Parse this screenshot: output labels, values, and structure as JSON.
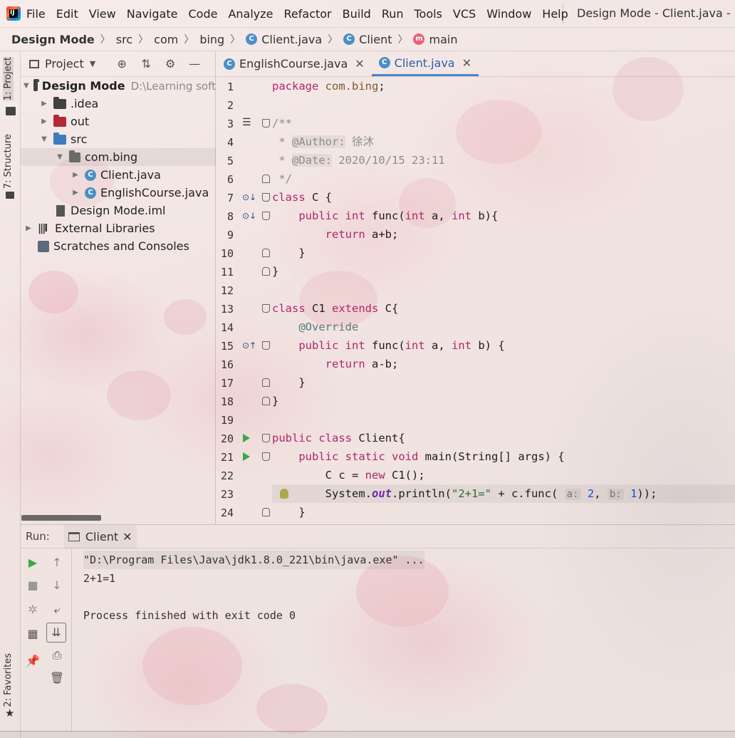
{
  "menu": {
    "items": [
      "File",
      "Edit",
      "View",
      "Navigate",
      "Code",
      "Analyze",
      "Refactor",
      "Build",
      "Run",
      "Tools",
      "VCS",
      "Window",
      "Help"
    ],
    "window_title": "Design Mode - Client.java - Inte"
  },
  "breadcrumb": {
    "project": "Design Mode",
    "src": "src",
    "com": "com",
    "bing": "bing",
    "file": "Client.java",
    "class": "Client",
    "method": "main"
  },
  "left_stripe": {
    "project_tab": "1: Project",
    "structure_tab": "7: Structure",
    "favorites_tab": "2: Favorites"
  },
  "project_panel": {
    "title": "Project",
    "tree": {
      "root": "Design Mode",
      "root_path": "D:\\Learning soft",
      "idea": ".idea",
      "out": "out",
      "src": "src",
      "package": "com.bing",
      "client": "Client.java",
      "english": "EnglishCourse.java",
      "iml": "Design Mode.iml",
      "ext_libs": "External Libraries",
      "scratches": "Scratches and Consoles"
    }
  },
  "editor": {
    "tabs": [
      {
        "label": "EnglishCourse.java",
        "active": false
      },
      {
        "label": "Client.java",
        "active": true
      }
    ],
    "line_numbers": [
      "1",
      "2",
      "3",
      "4",
      "5",
      "6",
      "7",
      "8",
      "9",
      "10",
      "11",
      "12",
      "13",
      "14",
      "15",
      "16",
      "17",
      "18",
      "19",
      "20",
      "21",
      "22",
      "23",
      "24"
    ],
    "code": {
      "package_kw": "package",
      "package_name": "com.bing",
      "semi": ";",
      "doc_open": "/**",
      "author_prefix": " * ",
      "author_tag": "@Author:",
      "author_value": " 徐沐",
      "date_prefix": " * ",
      "date_tag": "@Date:",
      "date_value": " 2020/10/15 23:11",
      "doc_close": " */",
      "class_kw": "class",
      "class_c": " C {",
      "l8_indent": "    ",
      "public_kw": "public",
      "int_kw": "int",
      "func_sig_a": " func(",
      "param_a": " a, ",
      "param_b": " b){",
      "l9_indent": "        ",
      "return_kw": "return",
      "return_sum": " a+b;",
      "close_inner": "    }",
      "close_outer": "}",
      "class_c1": " C1 ",
      "extends_kw": "extends",
      "extends_c": " C{",
      "override": "    @Override",
      "param_b15": " b) {",
      "return_diff": " a-b;",
      "class_client": " Client{",
      "static_kw": "static",
      "void_kw": "void",
      "main_sig": " main(String[] args) {",
      "l22_indent": "        ",
      "l22_decl": "C c = ",
      "new_kw": "new",
      "l22_rest": " C1();",
      "l23_system": "System.",
      "l23_out": "out",
      "l23_println": ".println(",
      "l23_str": "\"2+1=\"",
      "l23_plus": " + c.func( ",
      "hint_a": "a:",
      "arg_a": "2",
      "comma": ", ",
      "hint_b": "b:",
      "arg_b": "1",
      "l23_end": "));"
    }
  },
  "run_panel": {
    "label": "Run:",
    "tab": "Client",
    "console": {
      "command": "\"D:\\Program Files\\Java\\jdk1.8.0_221\\bin\\java.exe\" ...",
      "output": "2+1=1",
      "blank": "",
      "finish": "Process finished with exit code 0"
    }
  }
}
